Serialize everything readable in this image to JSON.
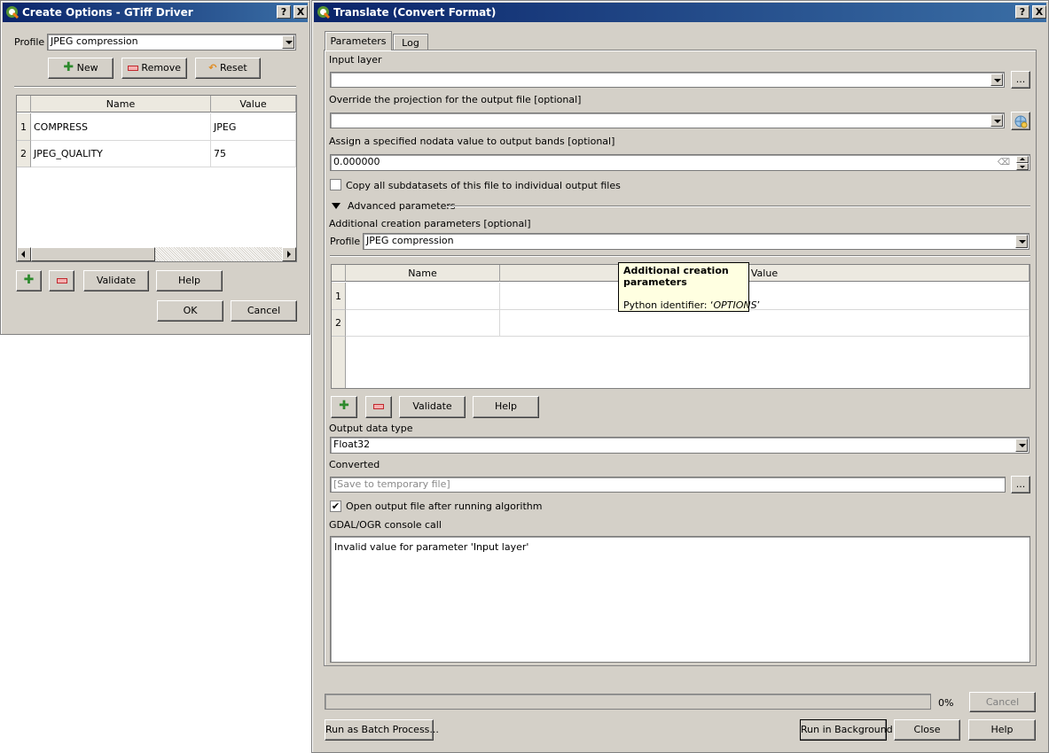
{
  "left_window": {
    "title": "Create Options - GTiff Driver",
    "help_btn": "?",
    "close_btn": "X",
    "profile_label": "Profile",
    "profile_value": "JPEG compression",
    "new_label": "New",
    "remove_label": "Remove",
    "reset_label": "Reset",
    "table": {
      "headers": [
        "Name",
        "Value"
      ],
      "rows": [
        {
          "num": "1",
          "name": "COMPRESS",
          "value": "JPEG"
        },
        {
          "num": "2",
          "name": "JPEG_QUALITY",
          "value": "75"
        }
      ]
    },
    "validate_label": "Validate",
    "help_label": "Help",
    "ok_label": "OK",
    "cancel_label": "Cancel"
  },
  "right_window": {
    "title": "Translate (Convert Format)",
    "help_btn": "?",
    "close_btn": "X",
    "tabs": [
      "Parameters",
      "Log"
    ],
    "input_layer_label": "Input layer",
    "input_layer_value": "",
    "browse_label": "...",
    "projection_label": "Override the projection for the output file [optional]",
    "projection_value": "",
    "nodata_label": "Assign a specified nodata value to output bands [optional]",
    "nodata_value": "0.000000",
    "copy_subdatasets_label": "Copy all subdatasets of this file to individual output files",
    "copy_subdatasets_checked": false,
    "advanced_label": "Advanced parameters",
    "creation_params_label": "Additional creation parameters [optional]",
    "profile_label": "Profile",
    "profile_value": "JPEG compression",
    "table": {
      "headers": [
        "Name",
        "Value"
      ],
      "rows": [
        {
          "num": "1",
          "name": "",
          "value": ""
        },
        {
          "num": "2",
          "name": "",
          "value": ""
        }
      ]
    },
    "tooltip": {
      "title": "Additional creation parameters",
      "python_prefix": "Python identifier: ‘",
      "python_id": "OPTIONS",
      "python_suffix": "’"
    },
    "validate_label": "Validate",
    "help_label": "Help",
    "output_type_label": "Output data type",
    "output_type_value": "Float32",
    "converted_label": "Converted",
    "converted_placeholder": "[Save to temporary file]",
    "open_output_label": "Open output file after running algorithm",
    "open_output_checked": true,
    "console_label": "GDAL/OGR console call",
    "console_text": "Invalid value for parameter 'Input layer'",
    "progress_text": "0%",
    "progress_value": 0,
    "cancel_label": "Cancel",
    "batch_label": "Run as Batch Process...",
    "background_label": "Run in Background",
    "close_label": "Close",
    "help_bottom_label": "Help"
  },
  "colors": {
    "title_start": "#0a246a",
    "title_end": "#3a6ea5",
    "window_bg": "#d4d0c8",
    "tooltip_bg": "#ffffe1",
    "qgis_green": "#589632"
  }
}
